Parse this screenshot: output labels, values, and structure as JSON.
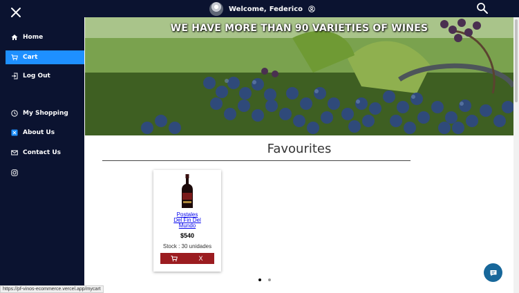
{
  "header": {
    "welcome_label": "Welcome,",
    "user_name": "Federico",
    "close_icon": "close-icon",
    "search_icon": "search-icon",
    "user_icon": "user-circle-icon"
  },
  "sidebar": {
    "items": [
      {
        "label": "Home",
        "icon": "home-icon"
      },
      {
        "label": "Cart",
        "icon": "cart-icon",
        "active": true
      },
      {
        "label": "Log Out",
        "icon": "logout-icon"
      },
      {
        "label": "My Shopping",
        "icon": "clock-icon"
      },
      {
        "label": "About Us",
        "icon": "info-icon"
      },
      {
        "label": "Contact Us",
        "icon": "mail-icon"
      },
      {
        "label": "",
        "icon": "instagram-icon"
      }
    ]
  },
  "hero": {
    "title": "WE HAVE MORE THAN 90 VARIETIES OF WINES"
  },
  "favourites": {
    "title": "Favourites",
    "products": [
      {
        "name_line1": "Postales",
        "name_line2": "Del Fin Del",
        "name_line3": "Mundo",
        "price": "$540",
        "stock": "Stock : 30 unidades",
        "remove_label": "X"
      }
    ]
  },
  "pagination": {
    "count": 2,
    "active": 0
  },
  "status_bar": {
    "url": "https://pf-vinos-ecommerce.vercel.app/mycart"
  },
  "colors": {
    "nav_bg": "#0b1330",
    "active_item": "#1e90ff",
    "button_red": "#9b1c20",
    "chat_button": "#17679a"
  }
}
